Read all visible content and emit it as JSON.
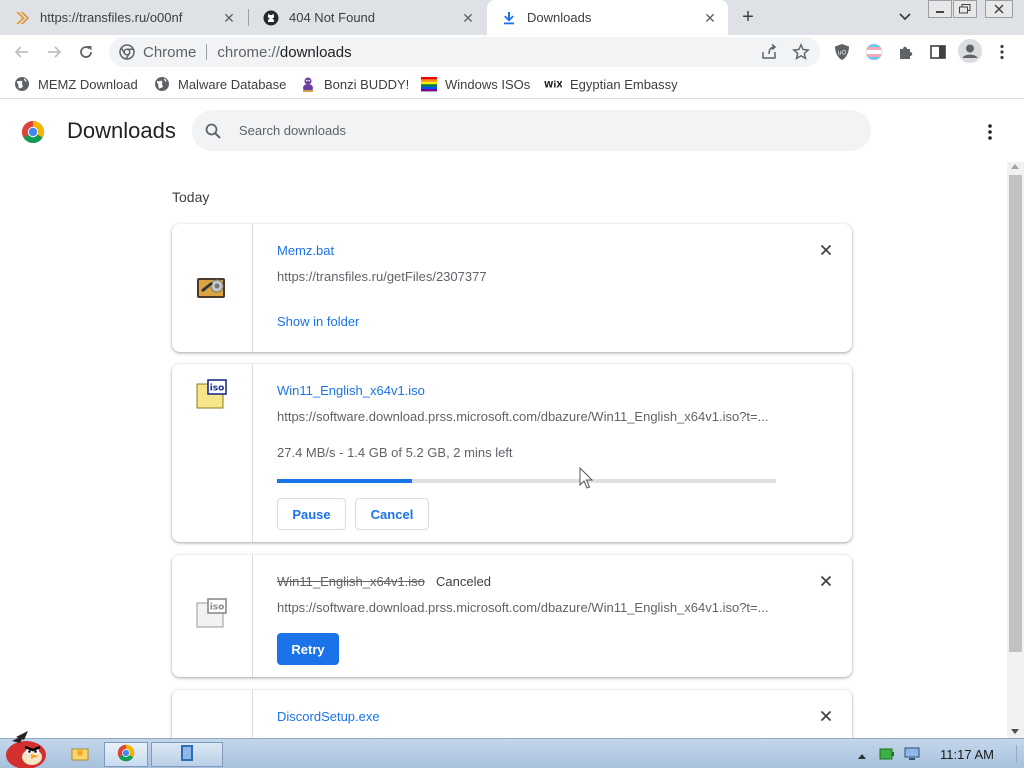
{
  "tabs": [
    {
      "title": "https://transfiles.ru/o00nf",
      "icon": "chevron-double-right-icon",
      "active": false
    },
    {
      "title": "404 Not Found",
      "icon": "github-icon",
      "active": false
    },
    {
      "title": "Downloads",
      "icon": "download-icon",
      "active": true
    }
  ],
  "omnibox": {
    "scheme_label": "Chrome",
    "url_prefix": "chrome://",
    "url_host": "downloads"
  },
  "bookmarks": [
    {
      "label": "MEMZ Download",
      "icon": "globe-icon"
    },
    {
      "label": "Malware Database",
      "icon": "globe-icon"
    },
    {
      "label": "Bonzi BUDDY!",
      "icon": "bonzi-icon"
    },
    {
      "label": "Windows ISOs",
      "icon": "rainbow-flag-icon"
    },
    {
      "label": "Egyptian Embassy",
      "icon": "wix-icon"
    }
  ],
  "page": {
    "title": "Downloads",
    "search_placeholder": "Search downloads",
    "section_label": "Today"
  },
  "downloads": [
    {
      "name": "Memz.bat",
      "url": "https://transfiles.ru/getFiles/2307377",
      "action_link": "Show in folder"
    },
    {
      "name": "Win11_English_x64v1.iso",
      "url": "https://software.download.prss.microsoft.com/dbazure/Win11_English_x64v1.iso?t=...",
      "progress_text": "27.4 MB/s - 1.4 GB of 5.2 GB, 2 mins left",
      "progress_fraction": 0.27,
      "pause_label": "Pause",
      "cancel_label": "Cancel"
    },
    {
      "name": "Win11_English_x64v1.iso",
      "status": "Canceled",
      "url": "https://software.download.prss.microsoft.com/dbazure/Win11_English_x64v1.iso?t=...",
      "retry_label": "Retry"
    },
    {
      "name": "DiscordSetup.exe"
    }
  ],
  "taskbar": {
    "clock": "11:17 AM"
  },
  "colors": {
    "accent": "#1a73e8",
    "tabstrip": "#dee1e6"
  }
}
